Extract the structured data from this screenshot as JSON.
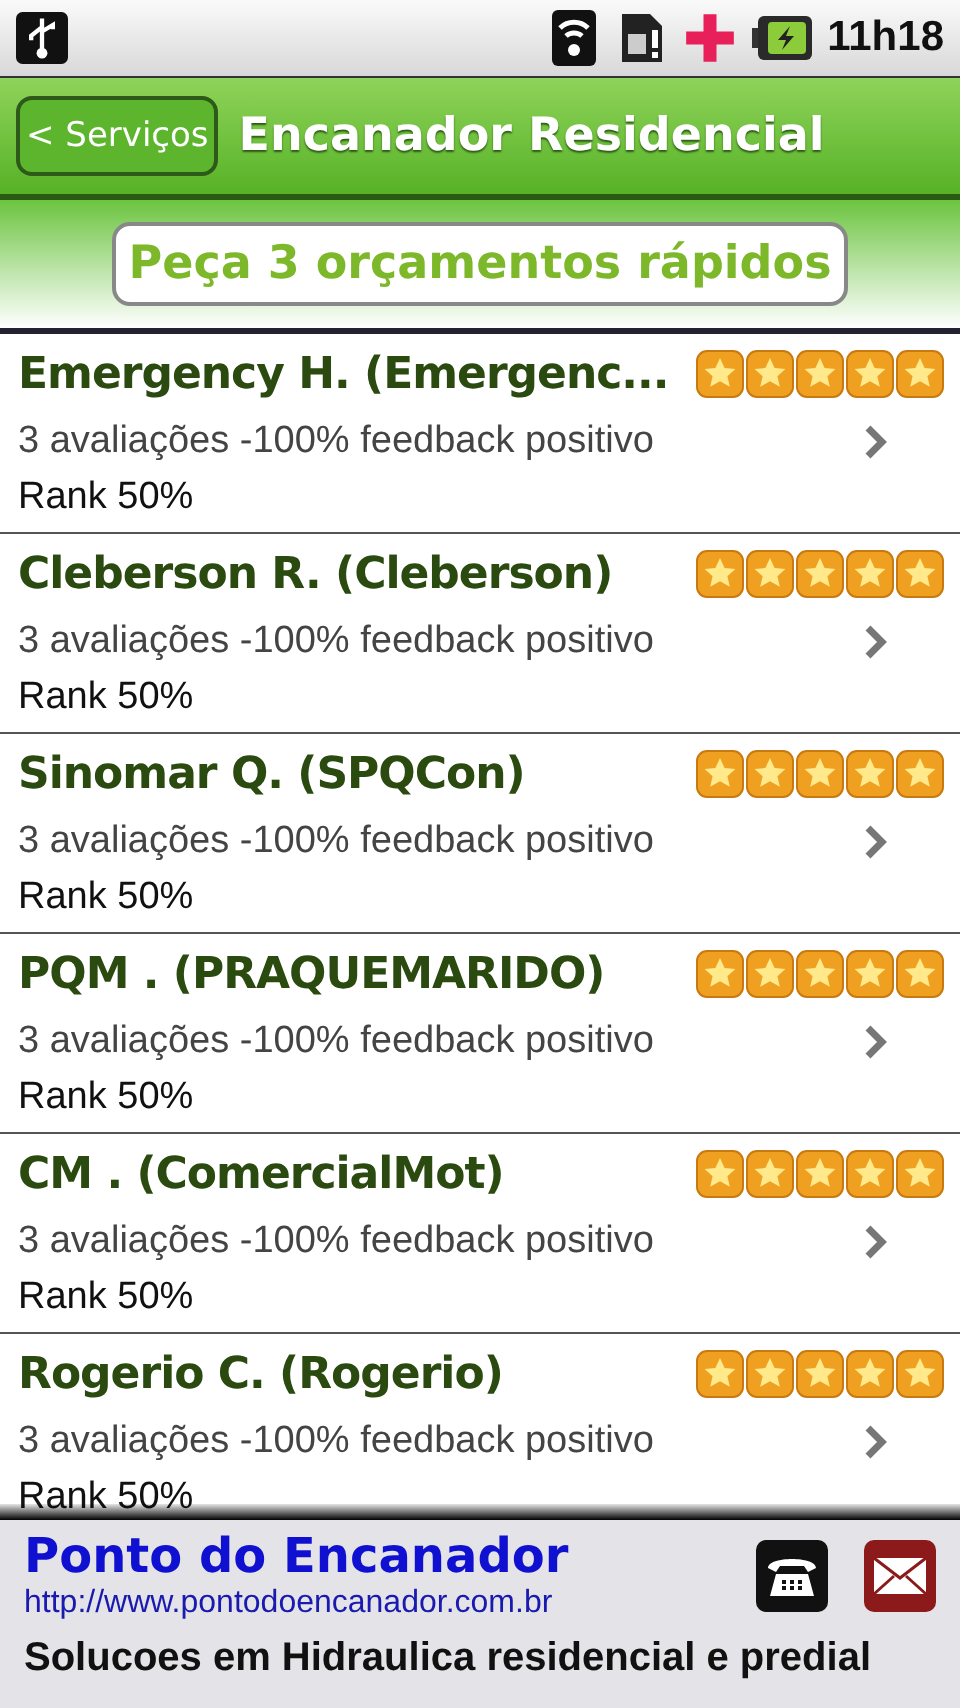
{
  "status_bar": {
    "time": "11h18"
  },
  "header": {
    "back_button": "< Serviços",
    "title": "Encanador Residencial"
  },
  "quote_button": "Peça 3 orçamentos rápidos",
  "providers": [
    {
      "name": "Emergency H. (Emergenc...",
      "stars": 5,
      "reviews": "3 avaliações -100% feedback positivo",
      "rank": "Rank 50%"
    },
    {
      "name": "Cleberson R. (Cleberson)",
      "stars": 5,
      "reviews": "3 avaliações -100% feedback positivo",
      "rank": "Rank 50%"
    },
    {
      "name": "Sinomar Q. (SPQCon)",
      "stars": 5,
      "reviews": "3 avaliações -100% feedback positivo",
      "rank": "Rank 50%"
    },
    {
      "name": "PQM . (PRAQUEMARIDO)",
      "stars": 5,
      "reviews": "3 avaliações -100% feedback positivo",
      "rank": "Rank 50%"
    },
    {
      "name": "CM . (ComercialMot)",
      "stars": 5,
      "reviews": "3 avaliações -100% feedback positivo",
      "rank": "Rank 50%"
    },
    {
      "name": "Rogerio C. (Rogerio)",
      "stars": 5,
      "reviews": "3 avaliações -100% feedback positivo",
      "rank": "Rank 50%"
    }
  ],
  "ad": {
    "title": "Ponto do Encanador",
    "url": "http://www.pontodoencanador.com.br",
    "tagline": "Solucoes em Hidraulica residencial e predial"
  }
}
